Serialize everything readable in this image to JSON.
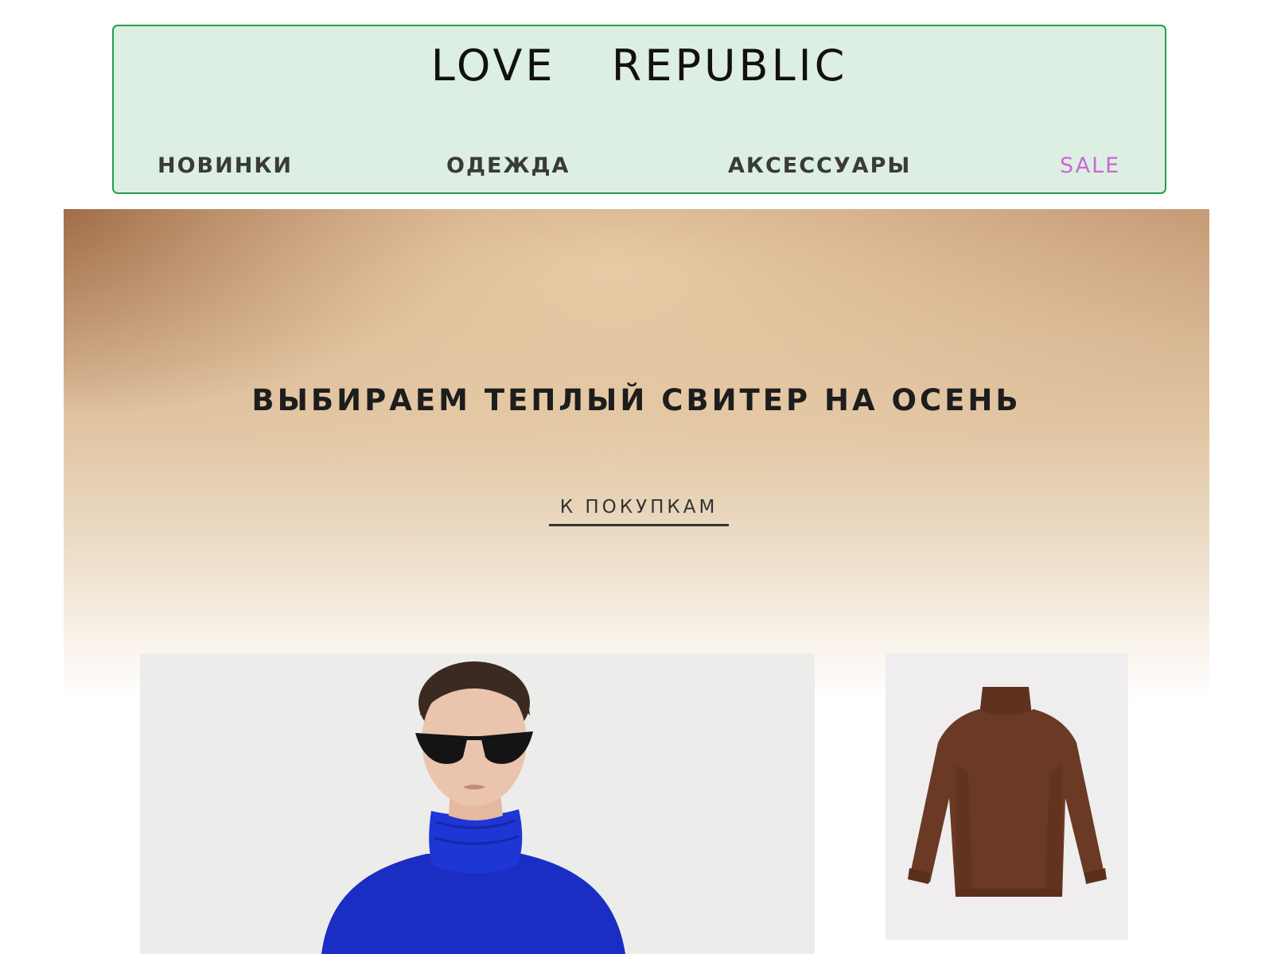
{
  "brand": {
    "logo_text": "LOVE  REPUBLIC"
  },
  "nav": {
    "items": [
      {
        "label": "НОВИНКИ"
      },
      {
        "label": "ОДЕЖДА"
      },
      {
        "label": "АКСЕССУАРЫ"
      },
      {
        "label": "SALE"
      }
    ]
  },
  "hero": {
    "title": "ВЫБИРАЕМ ТЕПЛЫЙ СВИТЕР НА ОСЕНЬ",
    "cta_label": "К ПОКУПКАМ"
  },
  "products": [
    {
      "image": "model-in-blue-turtleneck-sweater",
      "color": "#1a2ec4"
    },
    {
      "image": "brown-turtleneck-sweater",
      "color": "#6b3a24"
    }
  ],
  "colors": {
    "header_bg": "#dcefe2",
    "header_border": "#23a146",
    "sale": "#c86ad6"
  }
}
